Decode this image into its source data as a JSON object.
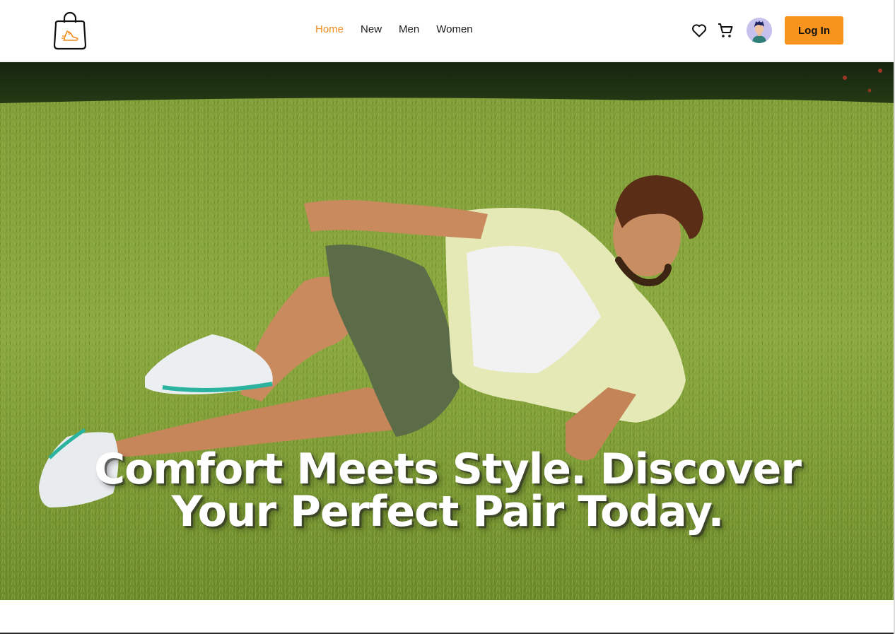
{
  "nav": {
    "links": [
      {
        "label": "Home",
        "active": true
      },
      {
        "label": "New",
        "active": false
      },
      {
        "label": "Men",
        "active": false
      },
      {
        "label": "Women",
        "active": false
      }
    ],
    "login_label": "Log In",
    "icons": {
      "logo": "shopping-bag-shoe-icon",
      "wishlist": "heart-icon",
      "cart": "cart-icon",
      "avatar": "user-avatar"
    },
    "accent_color": "#f7941d",
    "active_link_color": "#f28c1e"
  },
  "hero": {
    "title_line1": "Comfort Meets Style. Discover",
    "title_line2": "Your Perfect Pair Today."
  }
}
